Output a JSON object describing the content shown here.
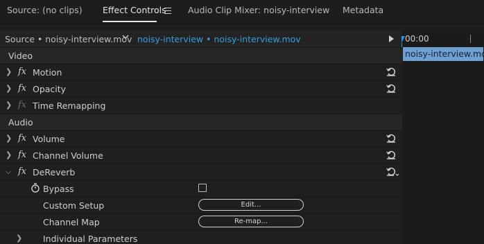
{
  "tabs": [
    {
      "label": "Source: (no clips)"
    },
    {
      "label": "Effect Controls"
    },
    {
      "label": "Audio Clip Mixer: noisy-interview"
    },
    {
      "label": "Metadata"
    }
  ],
  "source_bar": {
    "left": "Source • noisy-interview.mov",
    "right": "noisy-interview • noisy-interview.mov"
  },
  "timeline": {
    "time": "00:00",
    "clip": "noisy-interview.mov"
  },
  "rows": {
    "video_section": "Video",
    "motion": "Motion",
    "opacity": "Opacity",
    "time_remapping": "Time Remapping",
    "audio_section": "Audio",
    "volume": "Volume",
    "channel_volume": "Channel Volume",
    "dereverb": "DeReverb",
    "bypass": "Bypass",
    "custom_setup": "Custom Setup",
    "custom_setup_button": "Edit...",
    "channel_map": "Channel Map",
    "channel_map_button": "Re-map...",
    "individual_parameters": "Individual Parameters"
  },
  "fx_symbol": "fx",
  "colors": {
    "accent": "#3a9de0",
    "playhead": "#2f8de4",
    "clip": "#6fa0cf"
  }
}
